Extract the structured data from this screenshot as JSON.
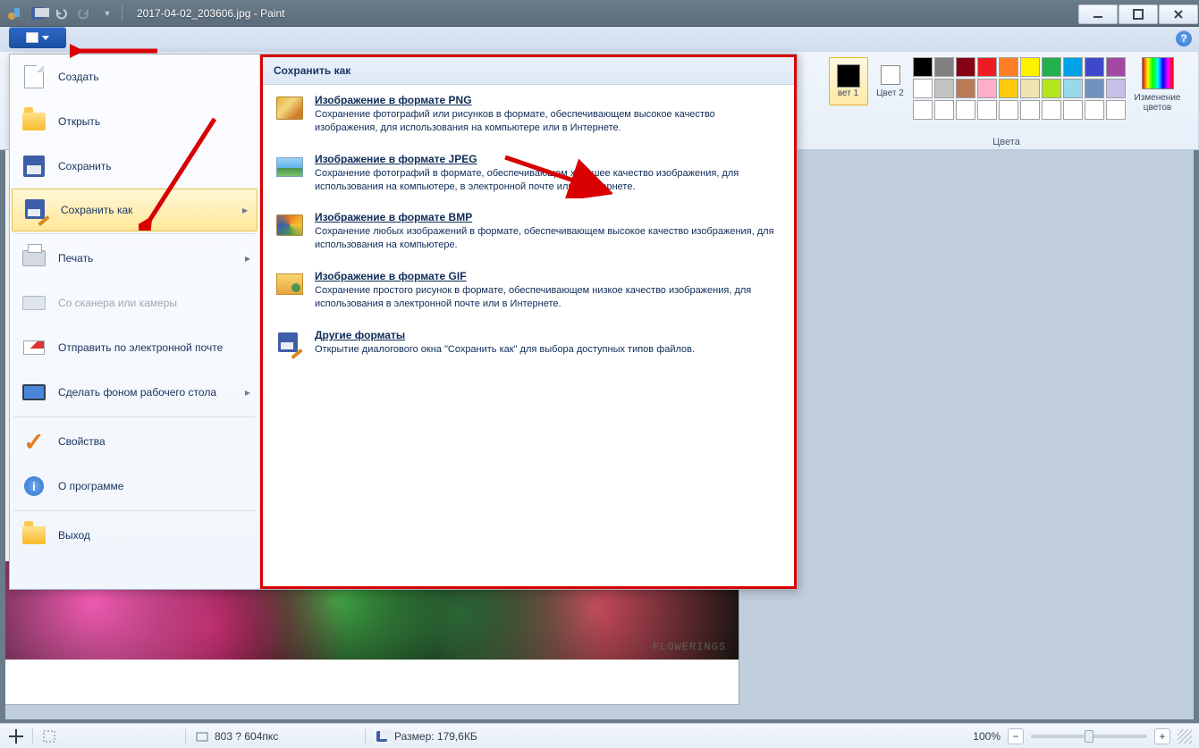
{
  "titlebar": {
    "title": "2017-04-02_203606.jpg - Paint"
  },
  "ribbon": {
    "color1_label": "вет\n1",
    "color2_label": "Цвет\n2",
    "edit_colors": "Изменение\nцветов",
    "colors_group": "Цвета",
    "palette_row1": [
      "#000000",
      "#7f7f7f",
      "#880015",
      "#ed1c24",
      "#ff7f27",
      "#fff200",
      "#22b14c",
      "#00a2e8",
      "#3f48cc",
      "#a349a4"
    ],
    "palette_row2": [
      "#ffffff",
      "#c3c3c3",
      "#b97a57",
      "#ffaec9",
      "#ffc90e",
      "#efe4b0",
      "#b5e61d",
      "#99d9ea",
      "#7092be",
      "#c8bfe7"
    ],
    "palette_row3": [
      "#ffffff",
      "#ffffff",
      "#ffffff",
      "#ffffff",
      "#ffffff",
      "#ffffff",
      "#ffffff",
      "#ffffff",
      "#ffffff",
      "#ffffff"
    ]
  },
  "filemenu": {
    "items": [
      {
        "key": "new",
        "label": "Создать"
      },
      {
        "key": "open",
        "label": "Открыть"
      },
      {
        "key": "save",
        "label": "Сохранить"
      },
      {
        "key": "saveas",
        "label": "Сохранить как"
      },
      {
        "key": "print",
        "label": "Печать"
      },
      {
        "key": "scanner",
        "label": "Со сканера или камеры"
      },
      {
        "key": "sendmail",
        "label": "Отправить по электронной почте"
      },
      {
        "key": "wallpaper",
        "label": "Сделать фоном рабочего стола"
      },
      {
        "key": "properties",
        "label": "Свойства"
      },
      {
        "key": "about",
        "label": "О программе"
      },
      {
        "key": "exit",
        "label": "Выход"
      }
    ],
    "submenu_title": "Сохранить как",
    "submenu": [
      {
        "key": "png",
        "title": "Изображение в формате PNG",
        "desc": "Сохранение фотографий или рисунков в формате, обеспечивающем высокое качество изображения, для использования на компьютере или в Интернете."
      },
      {
        "key": "jpeg",
        "title": "Изображение в формате JPEG",
        "desc": "Сохранение фотографий в формате, обеспечивающем хорошее качество изображения, для использования на компьютере, в электронной почте или в Интернете."
      },
      {
        "key": "bmp",
        "title": "Изображение в формате BMP",
        "desc": "Сохранение любых изображений в формате, обеспечивающем высокое качество изображения, для использования на компьютере."
      },
      {
        "key": "gif",
        "title": "Изображение в формате GIF",
        "desc": "Сохранение простого рисунок в формате, обеспечивающем низкое качество изображения, для использования в электронной почте или в Интернете."
      },
      {
        "key": "other",
        "title": "Другие форматы",
        "desc": "Открытие диалогового окна \"Сохранить как\" для выбора доступных типов файлов."
      }
    ]
  },
  "canvas": {
    "watermark": "FLOWERINGS"
  },
  "statusbar": {
    "dims": "803 ? 604пкс",
    "size_label": "Размер: 179,6КБ",
    "zoom": "100%"
  },
  "help_glyph": "?"
}
